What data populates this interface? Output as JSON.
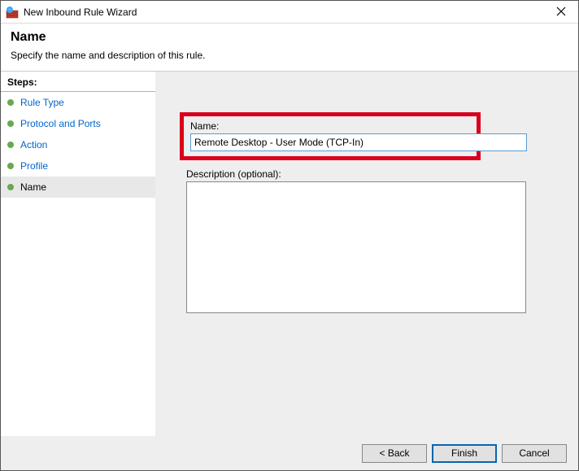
{
  "window": {
    "title": "New Inbound Rule Wizard"
  },
  "header": {
    "title": "Name",
    "description": "Specify the name and description of this rule."
  },
  "steps": {
    "heading": "Steps:",
    "items": [
      {
        "label": "Rule Type"
      },
      {
        "label": "Protocol and Ports"
      },
      {
        "label": "Action"
      },
      {
        "label": "Profile"
      },
      {
        "label": "Name"
      }
    ],
    "active_index": 4
  },
  "form": {
    "name_label": "Name:",
    "name_value": "Remote Desktop - User Mode (TCP-In)",
    "desc_label": "Description (optional):",
    "desc_value": ""
  },
  "buttons": {
    "back": "< Back",
    "finish": "Finish",
    "cancel": "Cancel"
  }
}
